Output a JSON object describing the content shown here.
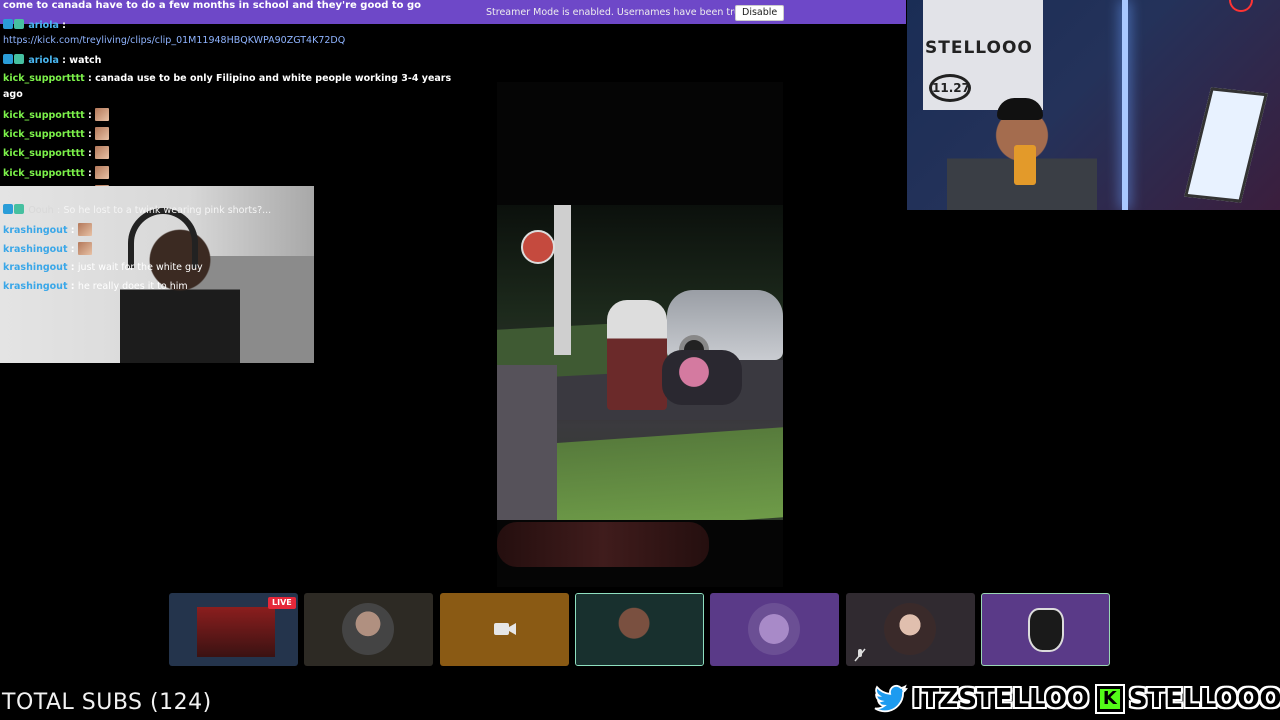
{
  "banner": {
    "first_line": "come to canada have to do a few months in school and they're good to go",
    "message": "Streamer Mode is enabled. Usernames have been truncated.",
    "disable_label": "Disable"
  },
  "chat": {
    "messages": [
      {
        "user": "ariola",
        "sep": ":",
        "text": ""
      },
      {
        "user": "",
        "sep": "",
        "text": "https://kick.com/treyliving/clips/clip_01M11948HBQKWPA90ZGT4K72DQ"
      },
      {
        "user": "ariola",
        "sep": ":",
        "text": "watch"
      },
      {
        "user": "kick_supportttt",
        "sep": ":",
        "text": "canada use to be only Filipino and white people working 3-4 years"
      },
      {
        "user": "",
        "sep": "",
        "text": "ago"
      },
      {
        "user": "kick_supportttt",
        "sep": ":",
        "text": ""
      },
      {
        "user": "kick_supportttt",
        "sep": ":",
        "text": ""
      },
      {
        "user": "kick_supportttt",
        "sep": ":",
        "text": ""
      },
      {
        "user": "kick_supportttt",
        "sep": ":",
        "text": ""
      },
      {
        "user": "kick_supportttt",
        "sep": ":",
        "text": ""
      },
      {
        "user": "Oouh",
        "sep": ":",
        "text": "So he lost to a twink wearing pink shorts?..."
      },
      {
        "user": "krashingout",
        "sep": ":",
        "text": ""
      },
      {
        "user": "krashingout",
        "sep": ":",
        "text": ""
      },
      {
        "user": "krashingout",
        "sep": ":",
        "text": "just wait for the white guy"
      },
      {
        "user": "krashingout",
        "sep": ":",
        "text": "he really does it to him"
      }
    ]
  },
  "participants": {
    "live_label": "LIVE"
  },
  "footer": {
    "total_subs": "TOTAL SUBS (124)",
    "twitter_handle": "ITZSTELLOO",
    "kick_letter": "K",
    "kick_handle": "STELLOOO"
  },
  "webcam": {
    "logo_text": "STELLOOO",
    "badge_text": "11.27"
  },
  "colors": {
    "banner": "#6e48c8",
    "username_green": "#7cf24a",
    "username_cyan": "#4ab8f2",
    "kick": "#53fc18",
    "live": "#e5283a"
  },
  "icons": [
    "twitter-icon",
    "kick-icon",
    "camera-icon",
    "mic-off-icon",
    "badge-icon",
    "emote-icon"
  ]
}
